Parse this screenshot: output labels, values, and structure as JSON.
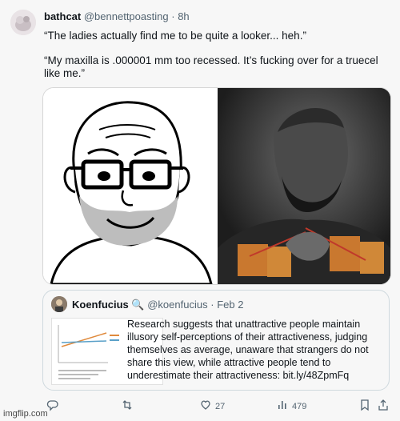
{
  "author": {
    "name": "bathcat",
    "handle": "@bennettpoasting",
    "separator": "·",
    "time": "8h"
  },
  "tweet": {
    "line1": "“The ladies actually find me to be quite a looker... heh.”",
    "line2": "“My maxilla is .000001 mm too recessed. It’s fucking over for a truecel like me.”"
  },
  "quote": {
    "name": "Koenfucius",
    "emoji": "🔍",
    "handle": "@koenfucius",
    "separator": "·",
    "time": "Feb 2",
    "text": "Research suggests that unattractive people maintain illusory self-perceptions of their attractiveness, judging themselves as average, unaware that strangers do not share this view, while attractive people tend to underestimate their attractiveness: bit.ly/48ZpmFq"
  },
  "actions": {
    "reply_count": "",
    "retweet_count": "",
    "like_count": "27",
    "views_count": "479"
  },
  "watermark": "imgflip.com",
  "icons": [
    "reply-icon",
    "retweet-icon",
    "like-icon",
    "views-icon",
    "share-icon"
  ]
}
